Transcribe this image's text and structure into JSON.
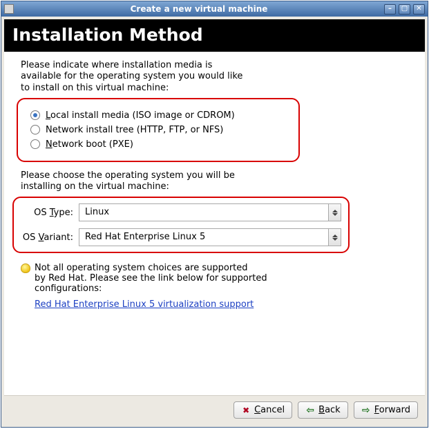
{
  "titlebar": {
    "title": "Create a new virtual machine"
  },
  "header": "Installation Method",
  "intro_line1": "Please indicate where installation media is",
  "intro_line2": "available for the operating system you would like",
  "intro_line3": "to install on this virtual machine:",
  "methods": {
    "local_pre": "L",
    "local_rest": "ocal install media (ISO image or CDROM)",
    "nettree": "Network install tree (HTTP, FTP, or NFS)",
    "netboot_pre": "N",
    "netboot_rest": "etwork boot (PXE)"
  },
  "os_intro_line1": "Please choose the operating system you will be",
  "os_intro_line2": "installing on the virtual machine:",
  "os_type_label_pre": "OS ",
  "os_type_label_u": "T",
  "os_type_label_post": "ype:",
  "os_type_value": "Linux",
  "os_variant_label_pre": "OS ",
  "os_variant_label_u": "V",
  "os_variant_label_post": "ariant:",
  "os_variant_value": "Red Hat Enterprise Linux 5",
  "tip_line1": "Not all operating system choices are supported",
  "tip_line2": "by Red Hat. Please see the link below for supported",
  "tip_line3": "configurations:",
  "support_link": "Red Hat Enterprise Linux 5 virtualization support",
  "buttons": {
    "cancel_u": "C",
    "cancel_rest": "ancel",
    "back_u": "B",
    "back_rest": "ack",
    "forward_u": "F",
    "forward_rest": "orward"
  }
}
